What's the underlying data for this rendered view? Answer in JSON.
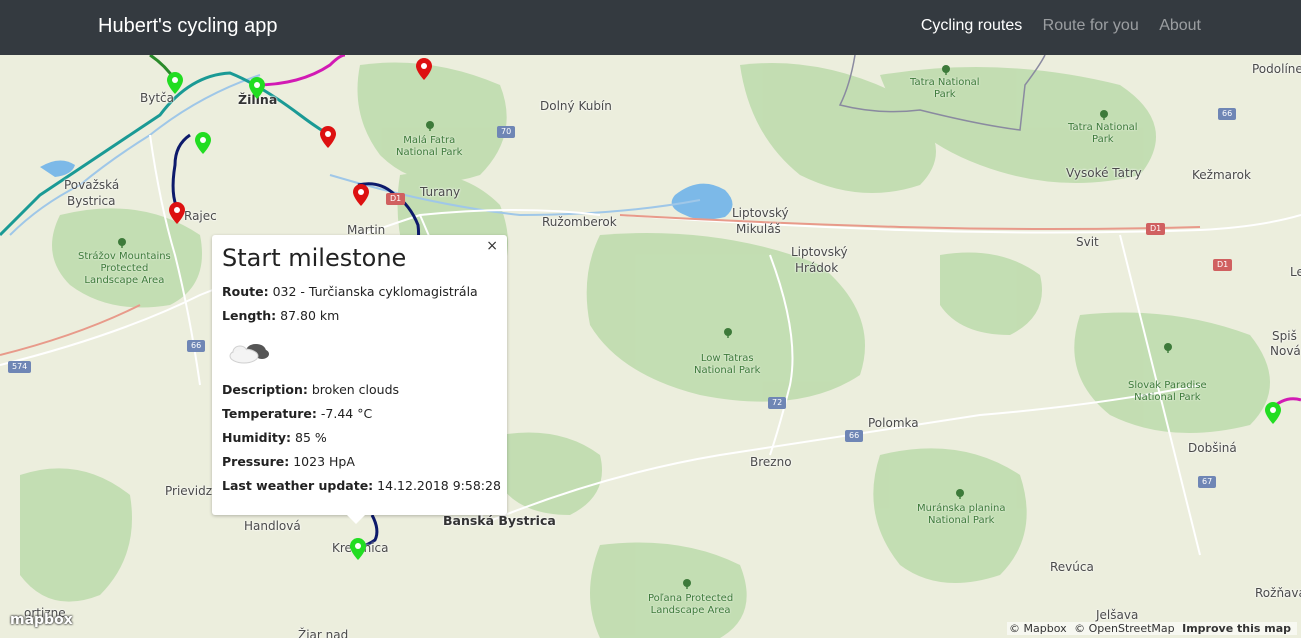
{
  "navbar": {
    "brand": "Hubert's cycling app",
    "links": [
      "Cycling routes",
      "Route for you",
      "About"
    ]
  },
  "map": {
    "places": {
      "bytca": "Bytča",
      "zilina": "Žilina",
      "dolny_kubin": "Dolný Kubín",
      "povazska_1": "Považská",
      "povazska_2": "Bystrica",
      "rajec": "Rajec",
      "turany": "Turany",
      "martin": "Martin",
      "ruzomberok": "Ružomberok",
      "liptovsky_mikulas_1": "Liptovský",
      "liptovsky_mikulas_2": "Mikuláš",
      "liptovsky_hradok_1": "Liptovský",
      "liptovsky_hradok_2": "Hrádok",
      "svit": "Svit",
      "vysoke_tatry": "Vysoké Tatry",
      "kezmarok": "Kežmarok",
      "podoline": "Podolíne",
      "spiss_1": "Spiš",
      "spiss_2": "Nová",
      "le": "Le",
      "prievidza": "Prievidz",
      "handlova": "Handlová",
      "banska_bystrica": "Banská Bystrica",
      "kremnica": "Kremnica",
      "brezno": "Brezno",
      "polomka": "Polomka",
      "dobsina": "Dobšiná",
      "revuca": "Revúca",
      "roznava": "Rožňava",
      "jelsava": "Jelšava",
      "zarnovica": "Žiar nad",
      "ortizne": "ortizne"
    },
    "parks": {
      "mala_fatra": "Malá Fatra\nNational Park",
      "tatra": "Tatra National\nPark",
      "tatra2": "Tatra National\nPark",
      "strazov": "Strážov Mountains\nProtected\nLandscape Area",
      "low_tatras": "Low Tatras\nNational Park",
      "slovak_paradise": "Slovak Paradise\nNational Park",
      "muranska": "Muránska planina\nNational Park",
      "polana": "Poľana Protected\nLandscape Area"
    },
    "shields": {
      "r70": "70",
      "r66a": "66",
      "r66b": "66",
      "r66c": "66",
      "r72": "72",
      "r67": "67",
      "r574": "574",
      "d1a": "D1",
      "d1b": "D1",
      "d1c": "D1"
    }
  },
  "popup": {
    "close": "×",
    "title": "Start milestone",
    "route_label": "Route:",
    "route_value": "032 - Turčianska cyklomagistrála",
    "length_label": "Length:",
    "length_value": "87.80 km",
    "weather_icon": "broken-clouds-icon",
    "description_label": "Description:",
    "description_value": "broken clouds",
    "temperature_label": "Temperature:",
    "temperature_value": "-7.44 °C",
    "humidity_label": "Humidity:",
    "humidity_value": "85 %",
    "pressure_label": "Pressure:",
    "pressure_value": "1023 HpA",
    "update_label": "Last weather update:",
    "update_value": "14.12.2018 9:58:28"
  },
  "attribution": {
    "logo": "mapbox",
    "mapbox": "© Mapbox",
    "osm": "© OpenStreetMap",
    "improve": "Improve this map"
  },
  "colors": {
    "navbar": "#343a40",
    "route_navy": "#0d1a6b",
    "route_teal": "#1a9a95",
    "route_magenta": "#d21ab4",
    "route_green": "#2a8a2a",
    "pin_green": "#22dd22",
    "pin_red": "#dd1111"
  }
}
